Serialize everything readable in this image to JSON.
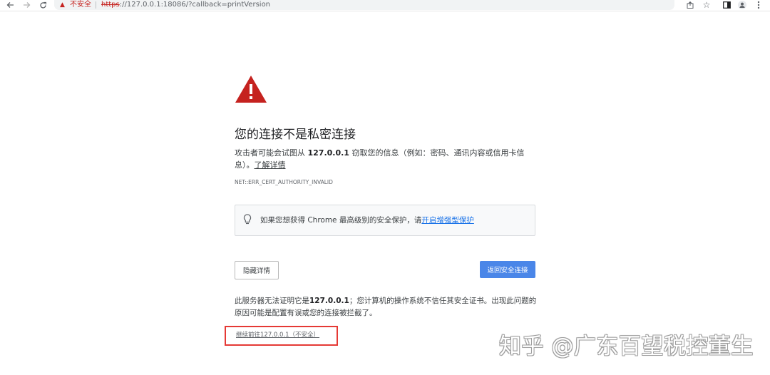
{
  "browser": {
    "back_icon": "arrow-left-icon",
    "forward_icon": "arrow-right-icon",
    "reload_icon": "reload-icon",
    "security_label": "不安全",
    "url_scheme": "https",
    "url_rest": "://127.0.0.1:18086/?callback=printVersion",
    "share_icon": "share-icon",
    "bookmark_icon": "star-icon",
    "sidepanel_icon": "side-panel-icon",
    "profile_icon": "profile-icon",
    "menu_icon": "kebab-menu-icon"
  },
  "interstitial": {
    "title": "您的连接不是私密连接",
    "desc_before": "攻击者可能会试图从 ",
    "host": "127.0.0.1",
    "desc_after": " 窃取您的信息（例如：密码、通讯内容或信用卡信息）。",
    "learn_more": "了解详情",
    "error_code": "NET::ERR_CERT_AUTHORITY_INVALID",
    "enhanced_text": "如果您想获得 Chrome 最高级别的安全保护，请",
    "enhanced_link": "开启增强型保护",
    "hide_details_label": "隐藏详情",
    "back_label": "返回安全连接",
    "details_before": "此服务器无法证明它是",
    "details_host": "127.0.0.1",
    "details_after": "；您计算机的操作系统不信任其安全证书。出现此问题的原因可能是配置有误或您的连接被拦截了。",
    "proceed_label": "继续前往127.0.0.1（不安全）"
  },
  "watermark": "知乎 @广东百望税控董生",
  "colors": {
    "warning_red": "#c5221f",
    "primary_blue": "#4a86e8",
    "highlight_box": "#e53935"
  }
}
